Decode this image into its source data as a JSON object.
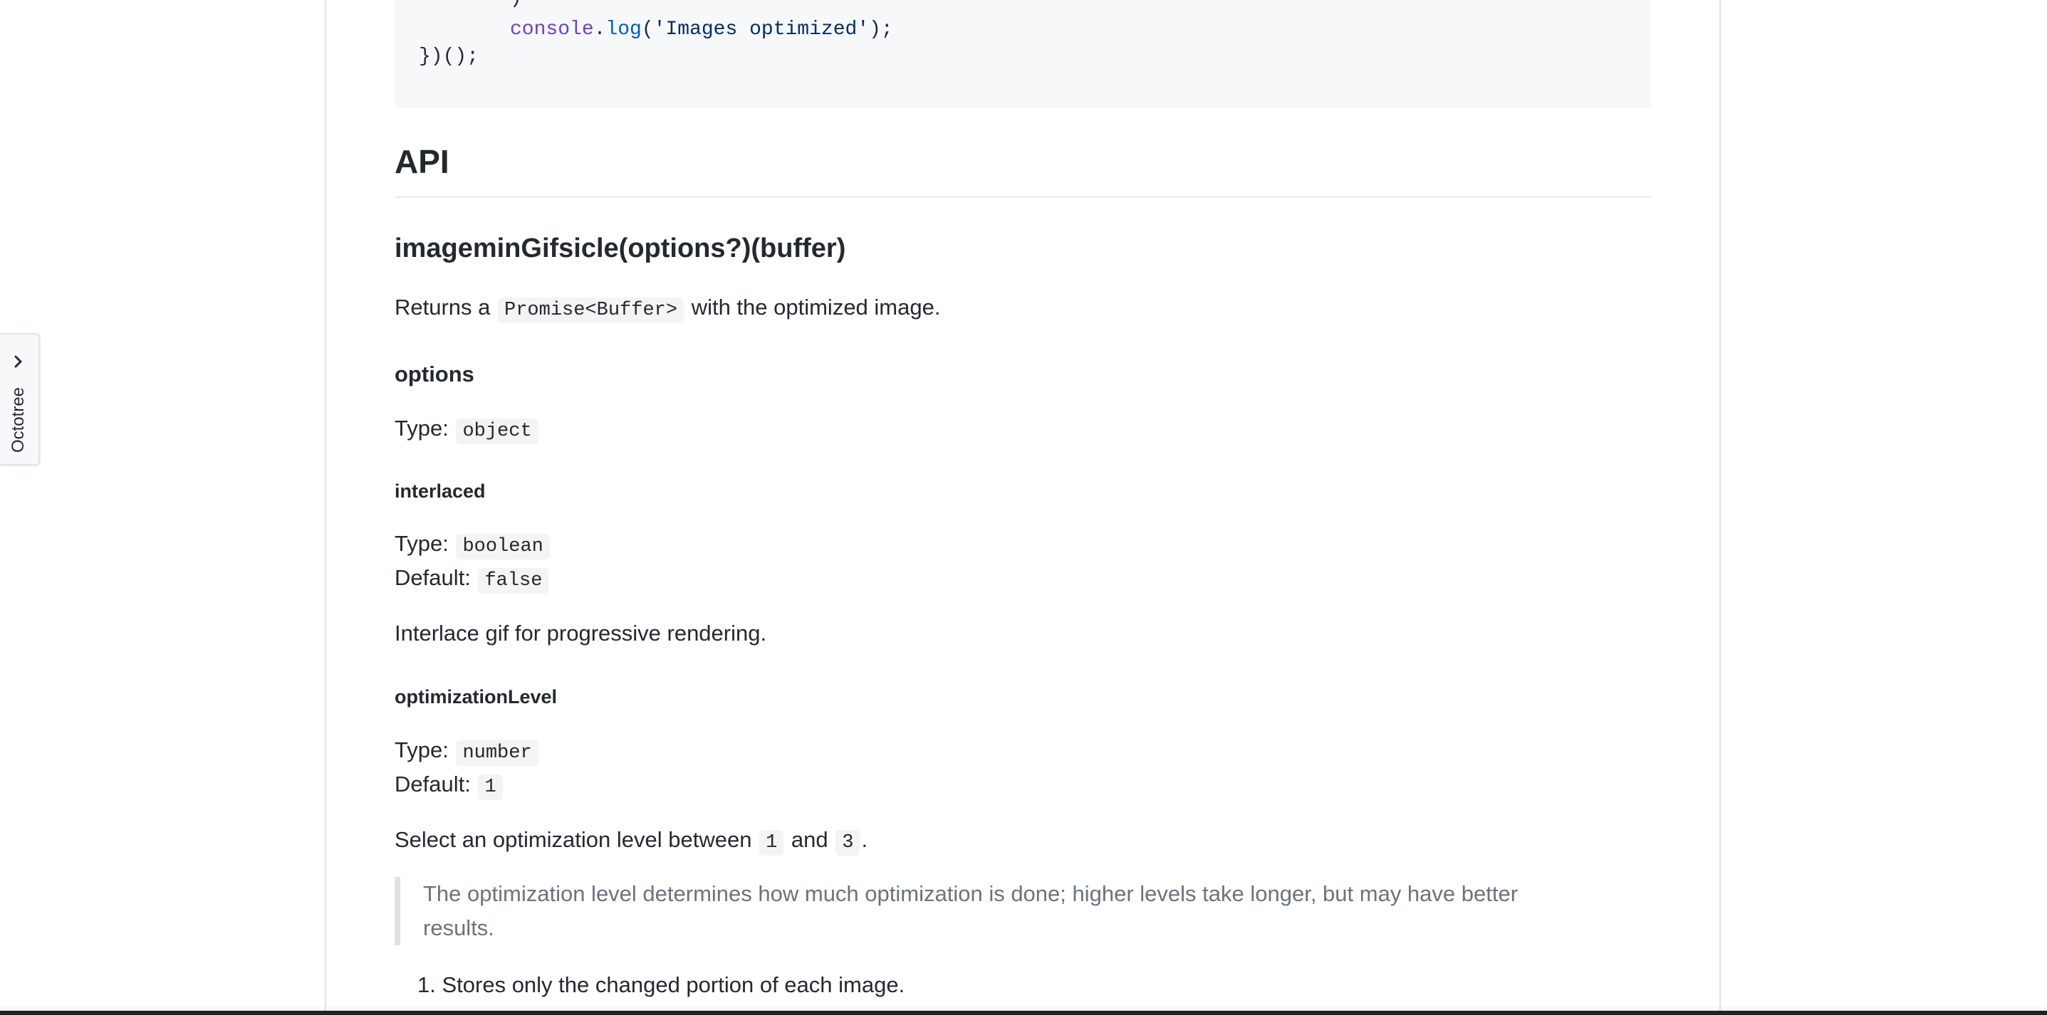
{
  "code": {
    "line0": ")",
    "line1_obj": "console",
    "line1_dot": ".",
    "line1_fn": "log",
    "line1_open": "(",
    "line1_str": "'Images optimized'",
    "line1_close": ");",
    "line2": "})();"
  },
  "api": {
    "heading": "API",
    "function_heading": "imageminGifsicle(options?)(buffer)",
    "returns_prefix": "Returns a ",
    "returns_code": "Promise<Buffer>",
    "returns_suffix": " with the optimized image."
  },
  "options": {
    "heading": "options",
    "type_label": "Type: ",
    "type_value": "object"
  },
  "interlaced": {
    "heading": "interlaced",
    "type_label": "Type: ",
    "type_value": "boolean",
    "default_label": "Default: ",
    "default_value": "false",
    "description": "Interlace gif for progressive rendering."
  },
  "optimizationLevel": {
    "heading": "optimizationLevel",
    "type_label": "Type: ",
    "type_value": "number",
    "default_label": "Default: ",
    "default_value": "1",
    "desc_prefix": "Select an optimization level between ",
    "desc_min": "1",
    "desc_mid": " and ",
    "desc_max": "3",
    "desc_suffix": ".",
    "quote_line1": "The optimization level determines how much optimization is done; higher levels take longer, but may have better",
    "quote_line2": "results.",
    "list_number": "1.",
    "list_item": "Stores only the changed portion of each image."
  },
  "octotree": {
    "label": "Octotree",
    "icon": "chevron-right-icon"
  }
}
